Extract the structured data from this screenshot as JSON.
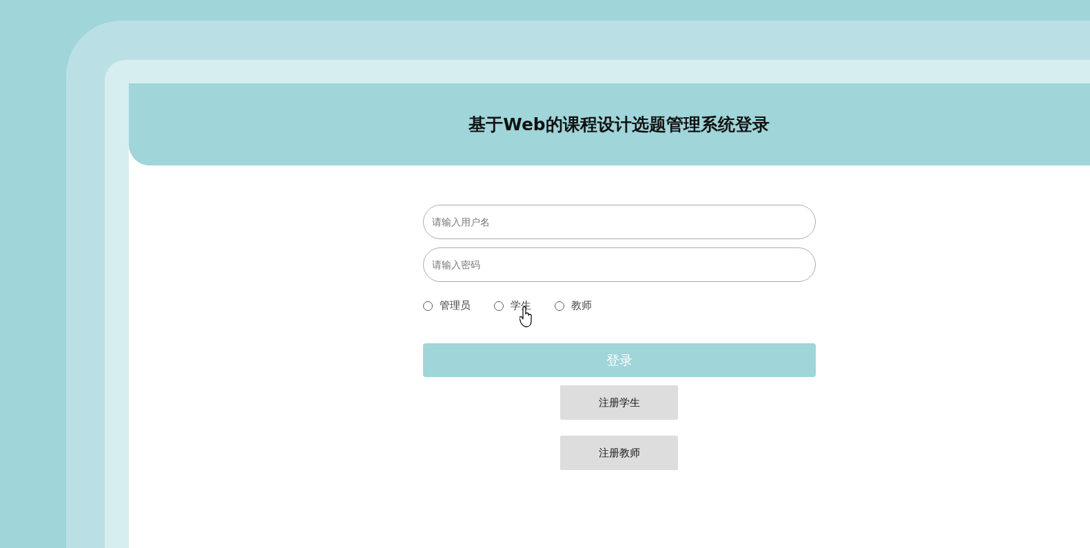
{
  "header": {
    "title": "基于Web的课程设计选题管理系统登录"
  },
  "form": {
    "username": {
      "placeholder": "请输入用户名"
    },
    "password": {
      "placeholder": "请输入密码"
    },
    "roles": [
      {
        "label": "管理员",
        "selected": false
      },
      {
        "label": "学生",
        "selected": false
      },
      {
        "label": "教师",
        "selected": false
      }
    ],
    "login_button": "登录",
    "register_buttons": [
      "注册学生",
      "注册教师"
    ]
  }
}
